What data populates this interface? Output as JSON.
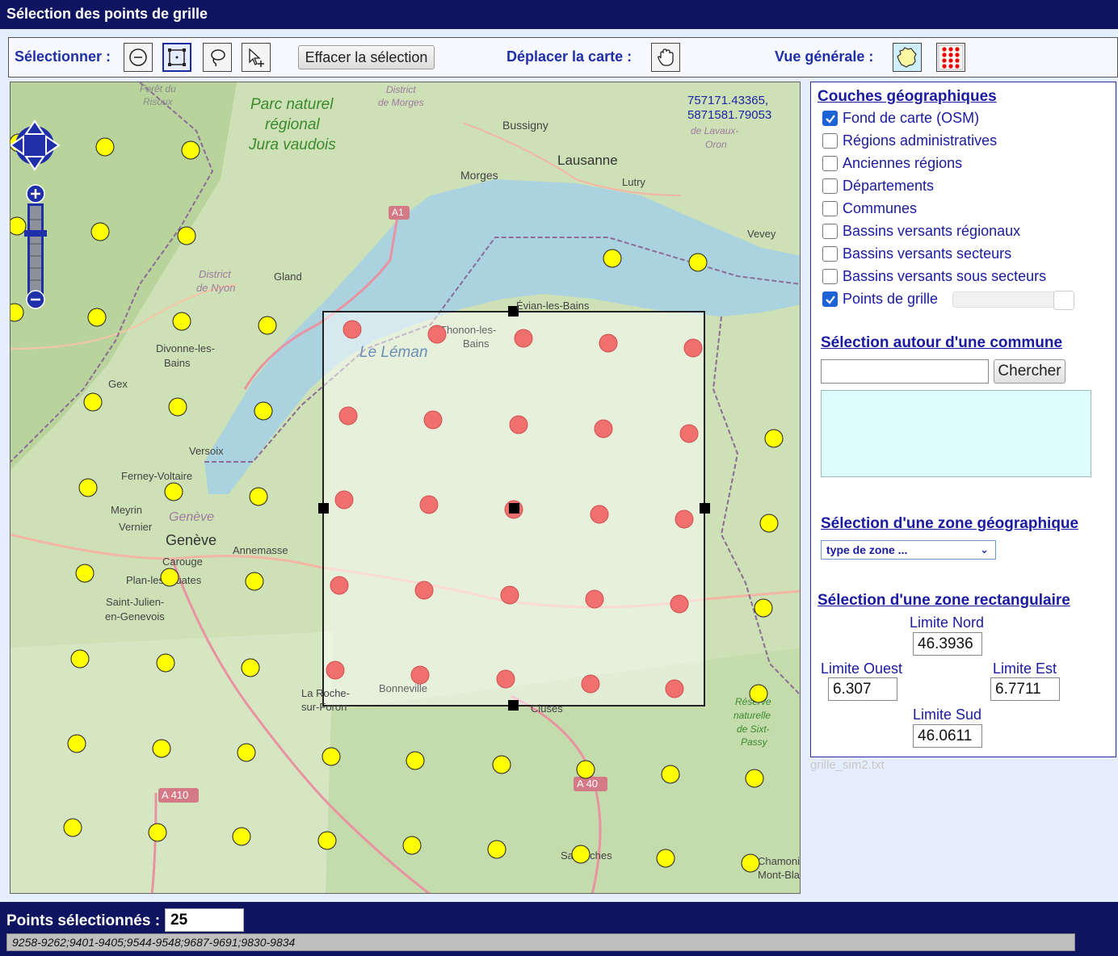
{
  "title": "Sélection des points de grille",
  "toolbar": {
    "select_label": "Sélectionner :",
    "clear_label": "Effacer la sélection",
    "move_label": "Déplacer la carte :",
    "overview_label": "Vue générale :"
  },
  "map": {
    "coords_line1": "757171.43365,",
    "coords_line2": "5871581.79053",
    "labels": [
      {
        "text": "Forêt du",
        "color": "#8a8a8a",
        "italic": true
      },
      {
        "text": "Risoux",
        "color": "#8a8a8a",
        "italic": true
      },
      {
        "text": "Parc naturel",
        "color": "#3b8a2e",
        "italic": true
      },
      {
        "text": "régional",
        "color": "#3b8a2e",
        "italic": true
      },
      {
        "text": "Jura vaudois",
        "color": "#3b8a2e",
        "italic": true
      },
      {
        "text": "District",
        "color": "#a07aa0",
        "italic": true
      },
      {
        "text": "de Morges",
        "color": "#a07aa0",
        "italic": true
      },
      {
        "text": "Bussigny",
        "color": "#444",
        "italic": false
      },
      {
        "text": "Lausanne",
        "color": "#333",
        "italic": false
      },
      {
        "text": "Lutry",
        "color": "#444",
        "italic": false
      },
      {
        "text": "Morges",
        "color": "#444",
        "italic": false
      },
      {
        "text": "de Lavaux-",
        "color": "#a07aa0",
        "italic": true
      },
      {
        "text": "Oron",
        "color": "#a07aa0",
        "italic": true
      },
      {
        "text": "A1",
        "color": "#fff",
        "italic": false
      },
      {
        "text": "Vevey",
        "color": "#444",
        "italic": false
      },
      {
        "text": "District",
        "color": "#a07aa0",
        "italic": true
      },
      {
        "text": "de Nyon",
        "color": "#a07aa0",
        "italic": true
      },
      {
        "text": "Gland",
        "color": "#444",
        "italic": false
      },
      {
        "text": "Évian-les-Bains",
        "color": "#444",
        "italic": false
      },
      {
        "text": "Thonon-les-",
        "color": "#666",
        "italic": false
      },
      {
        "text": "Bains",
        "color": "#666",
        "italic": false
      },
      {
        "text": "Le Léman",
        "color": "#6a8fb8",
        "italic": true
      },
      {
        "text": "Divonne-les-",
        "color": "#444",
        "italic": false
      },
      {
        "text": "Bains",
        "color": "#444",
        "italic": false
      },
      {
        "text": "Gex",
        "color": "#444",
        "italic": false
      },
      {
        "text": "Versoix",
        "color": "#444",
        "italic": false
      },
      {
        "text": "Ferney-Voltaire",
        "color": "#444",
        "italic": false
      },
      {
        "text": "Meyrin",
        "color": "#444",
        "italic": false
      },
      {
        "text": "Genève",
        "color": "#a07aa0",
        "italic": true
      },
      {
        "text": "Vernier",
        "color": "#444",
        "italic": false
      },
      {
        "text": "Genève",
        "color": "#333",
        "italic": false
      },
      {
        "text": "Annemasse",
        "color": "#444",
        "italic": false
      },
      {
        "text": "Carouge",
        "color": "#444",
        "italic": false
      },
      {
        "text": "Plan-les-Ouates",
        "color": "#444",
        "italic": false
      },
      {
        "text": "Saint-Julien-",
        "color": "#444",
        "italic": false
      },
      {
        "text": "en-Genevois",
        "color": "#444",
        "italic": false
      },
      {
        "text": "Bonneville",
        "color": "#666",
        "italic": false
      },
      {
        "text": "La Roche-",
        "color": "#444",
        "italic": false
      },
      {
        "text": "sur-Foron",
        "color": "#444",
        "italic": false
      },
      {
        "text": "Cluses",
        "color": "#444",
        "italic": false
      },
      {
        "text": "Réserve",
        "color": "#3b8a2e",
        "italic": true
      },
      {
        "text": "naturelle",
        "color": "#3b8a2e",
        "italic": true
      },
      {
        "text": "de Sixt-",
        "color": "#3b8a2e",
        "italic": true
      },
      {
        "text": "Passy",
        "color": "#3b8a2e",
        "italic": true
      },
      {
        "text": "A 40",
        "color": "#fff",
        "italic": false
      },
      {
        "text": "A 410",
        "color": "#fff",
        "italic": false
      },
      {
        "text": "Sallanches",
        "color": "#444",
        "italic": false
      },
      {
        "text": "Chamonix-",
        "color": "#444",
        "italic": false
      },
      {
        "text": "Mont-Blanc",
        "color": "#444",
        "italic": false
      }
    ]
  },
  "panel": {
    "layers_title": "Couches géographiques",
    "layers": [
      {
        "label": "Fond de carte (OSM)",
        "checked": true
      },
      {
        "label": "Régions administratives",
        "checked": false
      },
      {
        "label": "Anciennes régions",
        "checked": false
      },
      {
        "label": "Départements",
        "checked": false
      },
      {
        "label": "Communes",
        "checked": false
      },
      {
        "label": "Bassins versants régionaux",
        "checked": false
      },
      {
        "label": "Bassins versants secteurs",
        "checked": false
      },
      {
        "label": "Bassins versants sous secteurs",
        "checked": false
      },
      {
        "label": "Points de grille",
        "checked": true
      }
    ],
    "commune_title": "Sélection autour d'une commune",
    "commune_value": "",
    "search_label": "Chercher",
    "zone_title": "Sélection d'une zone géographique",
    "zone_select": "type de zone ...",
    "rect_title": "Sélection d'une zone rectangulaire",
    "nord_label": "Limite Nord",
    "nord_value": "46.3936",
    "ouest_label": "Limite Ouest",
    "ouest_value": "6.307",
    "est_label": "Limite Est",
    "est_value": "6.7711",
    "sud_label": "Limite Sud",
    "sud_value": "46.0611"
  },
  "filename": "grille_sim2.txt",
  "footer": {
    "selected_label": "Points sélectionnés :",
    "selected_count": "25",
    "ids": "9258-9262;9401-9405;9544-9548;9687-9691;9830-9834"
  }
}
